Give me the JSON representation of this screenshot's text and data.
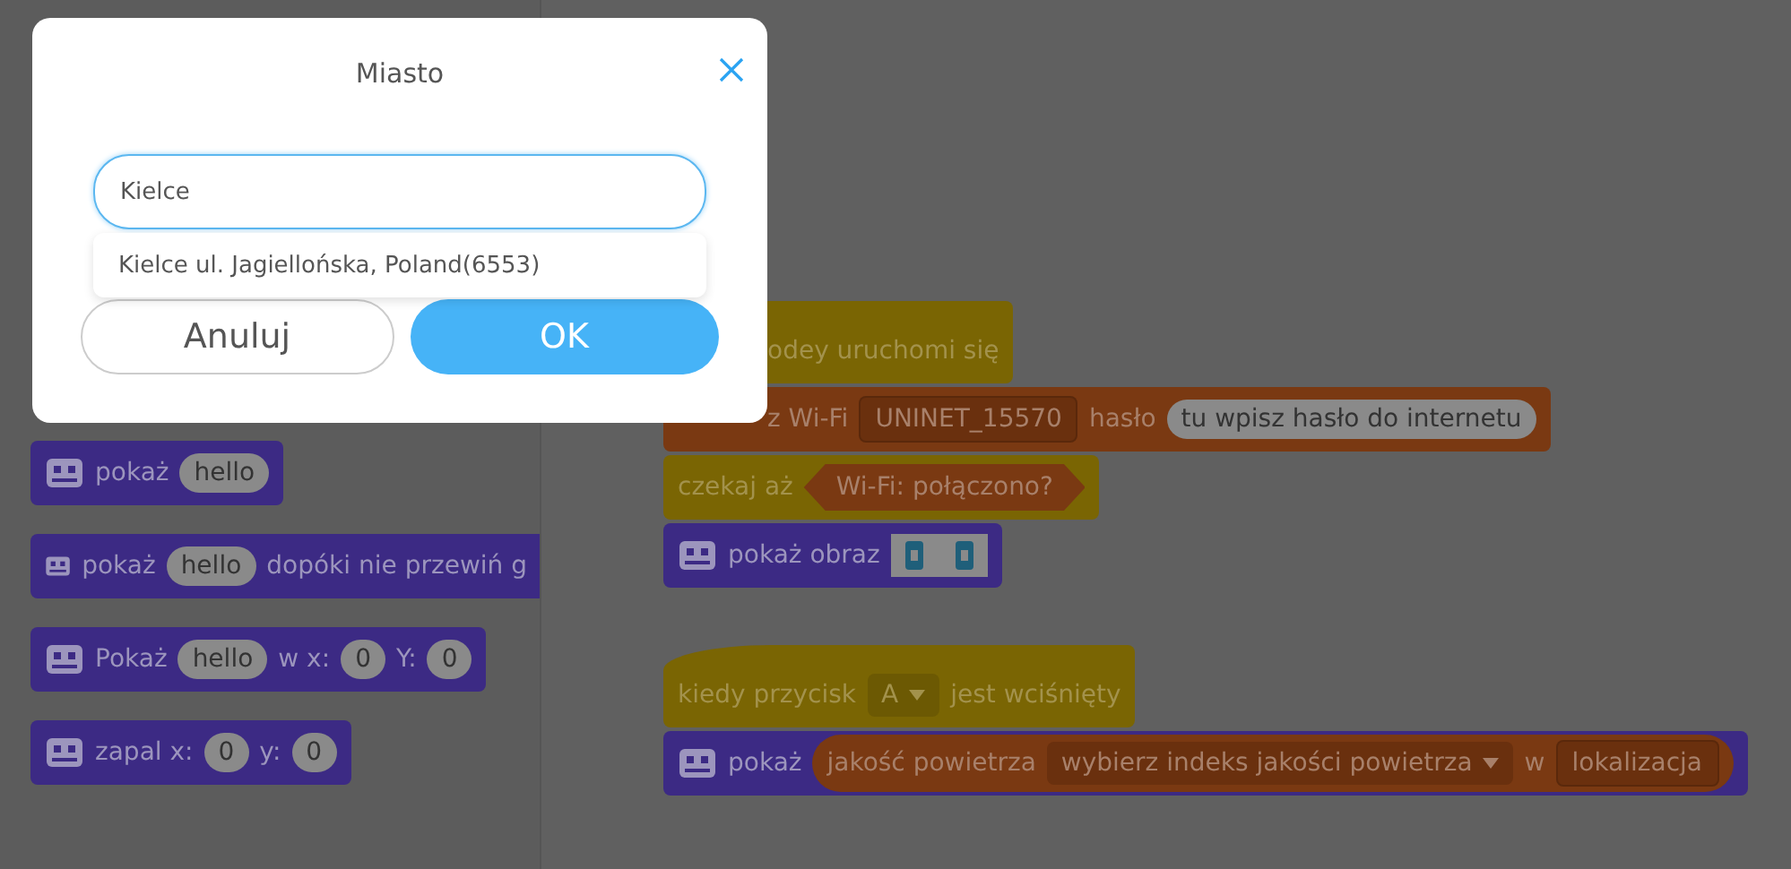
{
  "palette": [
    {
      "cut": false,
      "parts": [
        {
          "kind": "text",
          "text": "pokaż"
        },
        {
          "kind": "input",
          "text": "hello"
        }
      ]
    },
    {
      "cut": true,
      "parts": [
        {
          "kind": "text",
          "text": "pokaż"
        },
        {
          "kind": "input",
          "text": "hello"
        },
        {
          "kind": "text",
          "text": "dopóki nie przewiń g"
        }
      ]
    },
    {
      "cut": false,
      "parts": [
        {
          "kind": "text",
          "text": "Pokaż"
        },
        {
          "kind": "input",
          "text": "hello"
        },
        {
          "kind": "text",
          "text": "w x:"
        },
        {
          "kind": "input",
          "text": "0"
        },
        {
          "kind": "text",
          "text": "Y:"
        },
        {
          "kind": "input",
          "text": "0"
        }
      ]
    },
    {
      "cut": false,
      "parts": [
        {
          "kind": "text",
          "text": "zapal x:"
        },
        {
          "kind": "input",
          "text": "0"
        },
        {
          "kind": "text",
          "text": "y:"
        },
        {
          "kind": "input",
          "text": "0"
        }
      ]
    }
  ],
  "scripts": [
    {
      "blocks": [
        {
          "kind": "event",
          "hat": true,
          "icon": false,
          "parts": [
            {
              "kind": "text",
              "text": "odey uruchomi się"
            }
          ]
        },
        {
          "kind": "wifi",
          "hat": false,
          "icon": false,
          "parts": [
            {
              "kind": "text",
              "text": "z Wi-Fi"
            },
            {
              "kind": "field",
              "text": "UNINET_15570"
            },
            {
              "kind": "text",
              "text": "hasło"
            },
            {
              "kind": "input",
              "text": "tu wpisz hasło do internetu"
            }
          ]
        },
        {
          "kind": "control",
          "hat": false,
          "icon": false,
          "parts": [
            {
              "kind": "text",
              "text": "czekaj aż"
            },
            {
              "kind": "boolean",
              "text": "Wi-Fi: połączono?"
            }
          ]
        },
        {
          "kind": "display",
          "hat": false,
          "icon": true,
          "parts": [
            {
              "kind": "text",
              "text": "pokaż obraz"
            },
            {
              "kind": "image"
            }
          ]
        }
      ]
    },
    {
      "blocks": [
        {
          "kind": "event",
          "hat": true,
          "icon": false,
          "parts": [
            {
              "kind": "text",
              "text": "kiedy przycisk"
            },
            {
              "kind": "dropdown",
              "text": "A"
            },
            {
              "kind": "text",
              "text": "jest wciśnięty"
            }
          ]
        },
        {
          "kind": "display",
          "hat": false,
          "icon": true,
          "parts": [
            {
              "kind": "text",
              "text": "pokaż"
            },
            {
              "kind": "reporter",
              "parts": [
                {
                  "kind": "text",
                  "text": "jakość powietrza"
                },
                {
                  "kind": "dropdown",
                  "text": "wybierz indeks jakości powietrza"
                },
                {
                  "kind": "text",
                  "text": "w"
                },
                {
                  "kind": "field",
                  "text": "lokalizacja"
                }
              ]
            }
          ]
        }
      ]
    }
  ],
  "dialog": {
    "title": "Miasto",
    "value": "Kielce",
    "suggestion": "Kielce ul. Jagiellońska, Poland(6553)",
    "cancel": "Anuluj",
    "ok": "OK"
  }
}
